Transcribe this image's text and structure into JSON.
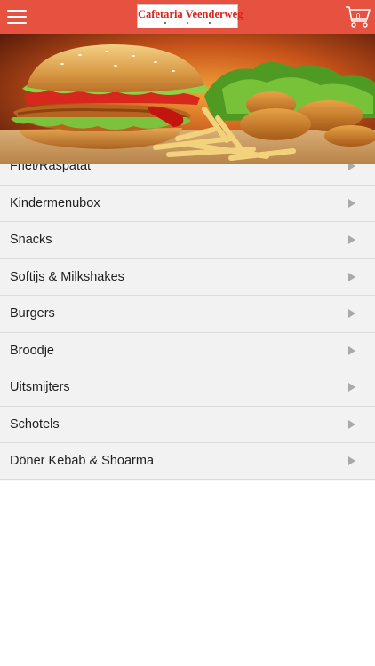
{
  "header": {
    "menu_icon": "hamburger-menu-icon",
    "logo_text": "Cafetaria Veenderweg",
    "cart_icon": "shopping-cart-icon",
    "cart_count": "0",
    "background_color": "#e7513f"
  },
  "hero": {
    "image": "burger-fries-chicken-banner"
  },
  "menu": {
    "arrow_icon": "chevron-right-triangle-icon",
    "items": [
      {
        "label": "Friet/Raspatat"
      },
      {
        "label": "Kindermenubox"
      },
      {
        "label": "Snacks"
      },
      {
        "label": "Softijs & Milkshakes"
      },
      {
        "label": "Burgers"
      },
      {
        "label": "Broodje"
      },
      {
        "label": "Uitsmijters"
      },
      {
        "label": "Schotels"
      },
      {
        "label": "Döner Kebab & Shoarma"
      }
    ]
  }
}
